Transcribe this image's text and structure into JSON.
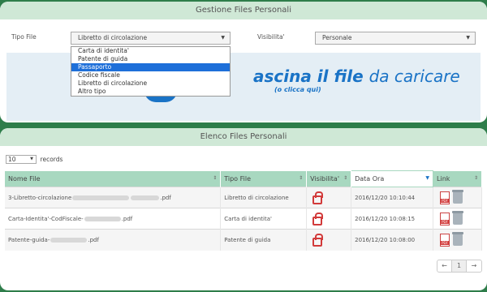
{
  "top_panel": {
    "title": "Gestione Files Personali",
    "tipo_file_label": "Tipo File",
    "tipo_file_value": "Libretto di circolazione",
    "visibilita_label": "Visibilita'",
    "visibilita_value": "Personale",
    "drop_text_bold": "ascina il file ",
    "drop_text_light": "da caricare",
    "drop_sub": "(o clicca qui)"
  },
  "dropdown_options": [
    "Carta di identita'",
    "Patente di guida",
    "Passaporto",
    "Codice fiscale",
    "Libretto di circolazione",
    "Altro tipo"
  ],
  "dropdown_selected_index": 2,
  "bottom_panel": {
    "title": "Elenco Files Personali",
    "records_value": "10",
    "records_label": "records"
  },
  "table": {
    "columns": [
      "Nome File",
      "Tipo File",
      "Visibilita'",
      "Data Ora",
      "Link"
    ],
    "rows": [
      {
        "name_prefix": "3-Libretto-circolazione",
        "name_suffix": ".pdf",
        "tipo": "Libretto di circolazione",
        "data": "2016/12/20 10:10:44"
      },
      {
        "name_prefix": "Carta-Identita'-CodFiscale-",
        "name_suffix": ".pdf",
        "tipo": "Carta di identita'",
        "data": "2016/12/20 10:08:15"
      },
      {
        "name_prefix": "Patente-guida-",
        "name_suffix": ".pdf",
        "tipo": "Patente di guida",
        "data": "2016/12/20 10:08:00"
      }
    ]
  },
  "pager": {
    "prev": "←",
    "page": "1",
    "next": "→"
  },
  "colors": {
    "background": "#2e7d4a",
    "header": "#cfe8d6",
    "table_header": "#a8d8c0",
    "accent_blue": "#1a73c6",
    "selection": "#1e6fd9",
    "icon_red": "#d23a3a"
  }
}
